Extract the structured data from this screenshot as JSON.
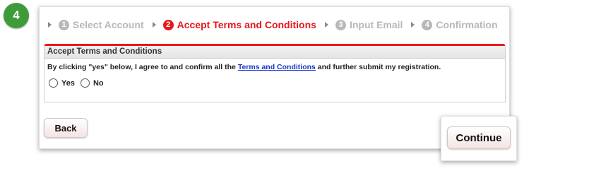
{
  "step_badge": "4",
  "wizard": {
    "steps": [
      {
        "num": "1",
        "label": "Select Account",
        "active": false
      },
      {
        "num": "2",
        "label": "Accept Terms and Conditions",
        "active": true
      },
      {
        "num": "3",
        "label": "Input Email",
        "active": false
      },
      {
        "num": "4",
        "label": "Confirmation",
        "active": false
      }
    ]
  },
  "section": {
    "title": "Accept Terms and Conditions",
    "text_before": "By clicking \"yes\" below, I agree to and confirm all the ",
    "link": "Terms and Conditions",
    "text_after": " and further submit my registration.",
    "options": [
      "Yes",
      "No"
    ],
    "selected": null
  },
  "buttons": {
    "back": "Back",
    "continue": "Continue"
  },
  "colors": {
    "accent": "#e8171b",
    "inactive": "#b8b8b8",
    "badge": "#3e9b3a",
    "link": "#1a37c9"
  }
}
